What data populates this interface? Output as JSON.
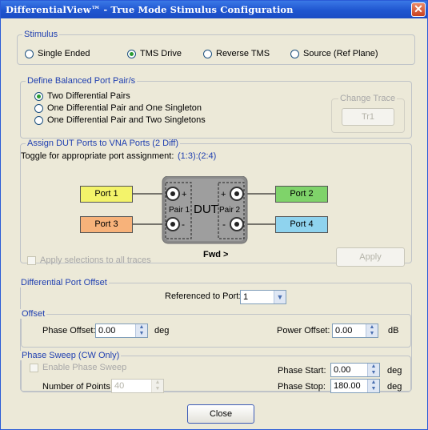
{
  "window": {
    "title": "DifferentialView™ - True Mode Stimulus Configuration",
    "close_glyph": "✕"
  },
  "stimulus": {
    "label": "Stimulus",
    "options": [
      "Single Ended",
      "TMS Drive",
      "Reverse TMS",
      "Source (Ref Plane)"
    ],
    "selected": "TMS Drive"
  },
  "balanced": {
    "label": "Define Balanced Port Pair/s",
    "options": [
      "Two Differential Pairs",
      "One Differential Pair and One Singleton",
      "One Differential Pair and Two Singletons"
    ],
    "selected": "Two Differential Pairs",
    "change_trace_label": "Change Trace",
    "trace_button": "Tr1"
  },
  "assign": {
    "label": "Assign DUT Ports to VNA Ports (2 Diff)",
    "toggle_text": "Toggle for appropriate port assignment:",
    "assignment": "(1:3):(2:4)",
    "ports": {
      "port1": "Port 1",
      "port2": "Port 2",
      "port3": "Port 3",
      "port4": "Port 4",
      "port1_color": "#f3f36a",
      "port2_color": "#7fd36a",
      "port3_color": "#f7b27a",
      "port4_color": "#8fd3ee"
    },
    "dut_label": "DUT",
    "pair1": "Pair 1",
    "pair2": "Pair 2",
    "plus": "+",
    "minus": "-",
    "fwd": "Fwd >",
    "apply_all_label": "Apply selections to all traces",
    "apply_button": "Apply"
  },
  "offset_section": {
    "label": "Differential Port Offset",
    "referenced_label": "Referenced to Port:",
    "referenced_value": "1",
    "offset": {
      "label": "Offset",
      "phase_offset_label": "Phase Offset:",
      "phase_offset_value": "0.00",
      "phase_unit": "deg",
      "power_offset_label": "Power Offset:",
      "power_offset_value": "0.00",
      "power_unit": "dB"
    },
    "sweep": {
      "label": "Phase Sweep (CW Only)",
      "enable_label": "Enable Phase Sweep",
      "points_label": "Number of Points:",
      "points_value": "40",
      "start_label": "Phase Start:",
      "start_value": "0.00",
      "stop_label": "Phase Stop:",
      "stop_value": "180.00",
      "unit": "deg"
    }
  },
  "close_button": "Close"
}
